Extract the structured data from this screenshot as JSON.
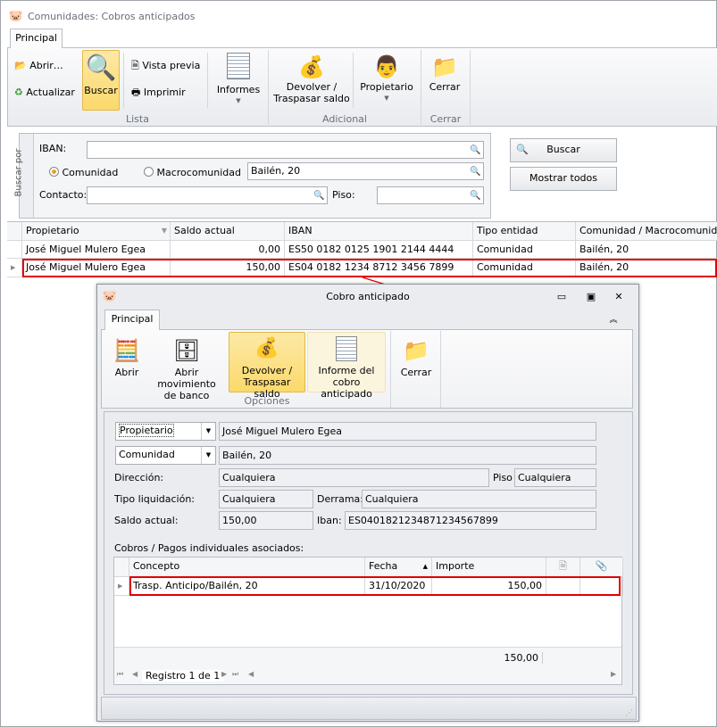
{
  "main": {
    "title": "Comunidades: Cobros anticipados",
    "tab": "Principal",
    "ribbon": {
      "abrir": "Abrir…",
      "actualizar": "Actualizar",
      "buscar": "Buscar",
      "vista_previa": "Vista previa",
      "imprimir": "Imprimir",
      "informes": "Informes",
      "devolver_1": "Devolver /",
      "devolver_2": "Traspasar saldo",
      "propietario": "Propietario",
      "cerrar": "Cerrar",
      "groups": {
        "lista": "Lista",
        "adicional": "Adicional",
        "cerrar": "Cerrar"
      }
    },
    "search": {
      "legend": "Buscar por",
      "iban_label": "IBAN:",
      "iban_value": "",
      "radio_comunidad": "Comunidad",
      "radio_macro": "Macrocomunidad",
      "comunidad_value": "Bailén, 20",
      "contacto_label": "Contacto:",
      "contacto_value": "",
      "piso_label": "Piso:",
      "piso_value": "",
      "buscar_btn": "Buscar",
      "mostrar_btn": "Mostrar todos"
    },
    "grid": {
      "columns": [
        "Propietario",
        "Saldo actual",
        "IBAN",
        "Tipo entidad",
        "Comunidad / Macrocomunidad"
      ],
      "rows": [
        [
          "José Miguel Mulero Egea",
          "0,00",
          "ES50 0182 0125 1901 2144 4444",
          "Comunidad",
          "Bailén, 20"
        ],
        [
          "José Miguel Mulero Egea",
          "150,00",
          "ES04 0182 1234 8712 3456 7899",
          "Comunidad",
          "Bailén, 20"
        ]
      ]
    }
  },
  "dialog": {
    "title": "Cobro anticipado",
    "tab": "Principal",
    "ribbon": {
      "abrir": "Abrir",
      "abrir_mov_1": "Abrir movimiento",
      "abrir_mov_2": "de banco",
      "devolver_1": "Devolver /",
      "devolver_2": "Traspasar saldo",
      "informe_1": "Informe del",
      "informe_2": "cobro anticipado",
      "cerrar": "Cerrar",
      "group": "Opciones"
    },
    "form": {
      "propietario_combo": "Propietario",
      "propietario_value": "José Miguel Mulero Egea",
      "comunidad_combo": "Comunidad",
      "comunidad_value": "Bailén, 20",
      "direccion_label": "Dirección:",
      "direccion_value": "Cualquiera",
      "piso_label": "Piso",
      "piso_value": "Cualquiera",
      "tipo_label": "Tipo liquidación:",
      "tipo_value": "Cualquiera",
      "derrama_label": "Derrama:",
      "derrama_value": "Cualquiera",
      "saldo_label": "Saldo actual:",
      "saldo_value": "150,00",
      "iban_label": "Iban:",
      "iban_value": "ES0401821234871234567899"
    },
    "grid": {
      "caption": "Cobros / Pagos individuales asociados:",
      "columns": [
        "Concepto",
        "Fecha",
        "Importe"
      ],
      "rows": [
        [
          "Trasp. Anticipo/Bailén, 20",
          "31/10/2020",
          "150,00"
        ]
      ],
      "total": "150,00",
      "navigator": "Registro 1 de 1"
    }
  }
}
